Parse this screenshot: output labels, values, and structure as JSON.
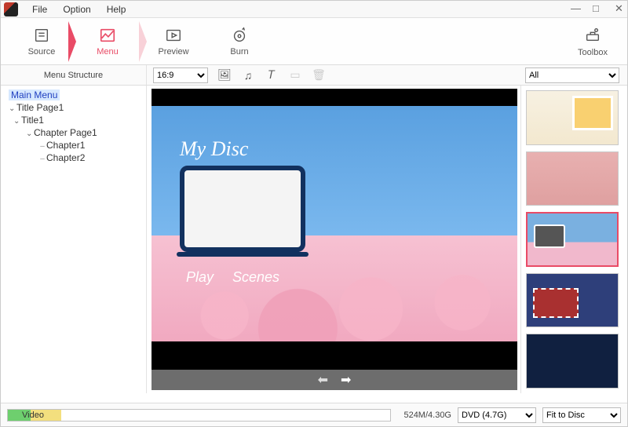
{
  "menubar": {
    "file": "File",
    "option": "Option",
    "help": "Help"
  },
  "wincontrols": {
    "min": "—",
    "max": "□",
    "close": "✕"
  },
  "steps": {
    "source": "Source",
    "menu": "Menu",
    "preview": "Preview",
    "burn": "Burn"
  },
  "toolbox": {
    "label": "Toolbox"
  },
  "secbar": {
    "structure_label": "Menu Structure",
    "aspect_ratio": "16:9",
    "theme_filter": "All"
  },
  "tree": {
    "main_menu": "Main Menu",
    "title_page": "Title Page1",
    "title1": "Title1",
    "chapter_page": "Chapter Page1",
    "chapter1": "Chapter1",
    "chapter2": "Chapter2"
  },
  "canvas": {
    "disc_title": "My Disc",
    "play_label": "Play",
    "scenes_label": "Scenes"
  },
  "status": {
    "video_label": "Video",
    "size_text": "524M/4.30G",
    "disc_type": "DVD (4.7G)",
    "fit": "Fit to Disc"
  },
  "icons": {
    "image": "🖼",
    "music": "♫",
    "text": "𝑇",
    "doc": "▭",
    "del": "🗑",
    "arrow_left": "⬅",
    "arrow_right": "➡"
  }
}
